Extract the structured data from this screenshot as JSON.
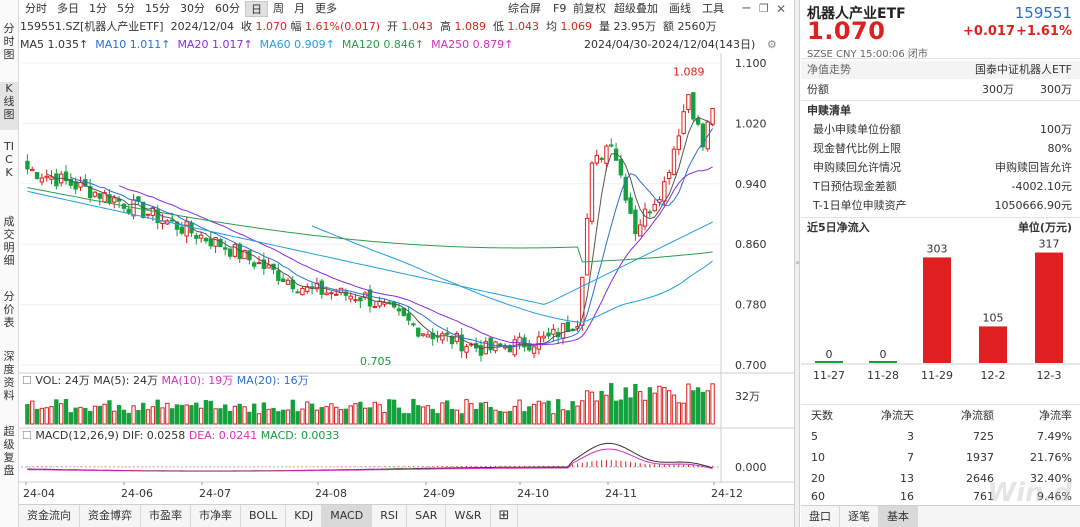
{
  "left_tabs": [
    "分时图",
    "K线图",
    "TICK",
    "成交明细",
    "分价表",
    "深度资料",
    "超级复盘"
  ],
  "toolbar": {
    "periods": [
      "分时",
      "多日",
      "1分",
      "5分",
      "15分",
      "30分",
      "60分",
      "日",
      "周",
      "月",
      "更多"
    ],
    "active_period": "日",
    "right_items": [
      "综合屏",
      "F9",
      "前复权",
      "超级叠加",
      "画线",
      "工具"
    ]
  },
  "quote": {
    "code_name": "159551.SZ[机器人产业ETF]",
    "date": "2024/12/04",
    "close": "收 1.070",
    "change": "幅 1.61%(0.017)",
    "open": "开 1.043",
    "high": "高 1.089",
    "low": "低 1.043",
    "avg": "均 1.069",
    "volume": "量 23.95万",
    "amount": "额 2560万"
  },
  "ma": {
    "ma5": "MA5 1.035↑",
    "ma10": "MA10 1.011↑",
    "ma20": "MA20 1.017↑",
    "ma60": "MA60 0.909↑",
    "ma120": "MA120 0.846↑",
    "ma250": "MA250 0.879↑"
  },
  "range_label": "2024/04/30-2024/12/04(143日)",
  "price_axis": [
    "1.100",
    "1.020",
    "0.940",
    "0.860",
    "0.780",
    "0.700"
  ],
  "price_annotations": {
    "high": "1.089",
    "low": "0.705"
  },
  "volume_header": {
    "vol": "VOL: 24万",
    "ma5": "MA(5): 24万",
    "ma10": "MA(10): 19万",
    "ma20": "MA(20): 16万"
  },
  "volume_axis": [
    "32万"
  ],
  "macd_header": {
    "title": "MACD(12,26,9)",
    "dif": "DIF: 0.0258",
    "dea": "DEA: 0.0241",
    "macd": "MACD: 0.0033"
  },
  "macd_axis": [
    "0.000"
  ],
  "date_axis": [
    "24-04",
    "24-06",
    "24-07",
    "24-08",
    "24-09",
    "24-10",
    "24-11",
    "24-12"
  ],
  "bottom_tabs": [
    "资金流向",
    "资金博弈",
    "市盈率",
    "市净率",
    "BOLL",
    "KDJ",
    "MACD",
    "RSI",
    "SAR",
    "W&R"
  ],
  "active_bottom_tab": "MACD",
  "right_panel": {
    "title": "机器人产业ETF",
    "code": "159551",
    "price": "1.070",
    "change": "+0.017",
    "change_pct": "+1.61%",
    "meta": "SZSE  CNY  15:00:06  闭市",
    "nav_label": "净值走势",
    "manager": "国泰中证机器人ETF",
    "shares_label": "份额",
    "shares_a": "300万",
    "shares_b": "300万",
    "subscription_title": "申赎清单",
    "subscription_rows": [
      {
        "label": "最小申赎单位份额",
        "value": "100万"
      },
      {
        "label": "现金替代比例上限",
        "value": "80%"
      },
      {
        "label": "申购赎回允许情况",
        "value": "申购赎回皆允许"
      },
      {
        "label": "T日预估现金差额",
        "value": "-4002.10元"
      },
      {
        "label": "T-1日单位申赎资产",
        "value": "1050666.90元"
      }
    ],
    "inflow_title": "近5日净流入",
    "inflow_unit": "单位(万元)",
    "inflow_colors": {
      "bar": "#e02020",
      "zero": "#14a03c"
    },
    "table_headers": [
      "天数",
      "净流天",
      "净流额",
      "净流率"
    ],
    "table_rows": [
      [
        "5",
        "3",
        "725",
        "7.49%"
      ],
      [
        "10",
        "7",
        "1937",
        "21.76%"
      ],
      [
        "20",
        "13",
        "2646",
        "32.40%"
      ],
      [
        "60",
        "16",
        "761",
        "9.46%"
      ]
    ],
    "footer_tabs": [
      "盘口",
      "逐笔",
      "基本"
    ],
    "active_footer_tab": "基本",
    "watermark": "Win.d"
  },
  "chart_data": [
    {
      "type": "bar",
      "title": "近5日净流入",
      "ylabel": "单位(万元)",
      "categories": [
        "11-27",
        "11-28",
        "11-29",
        "12-2",
        "12-3"
      ],
      "values": [
        0,
        0,
        303,
        105,
        317
      ]
    }
  ]
}
